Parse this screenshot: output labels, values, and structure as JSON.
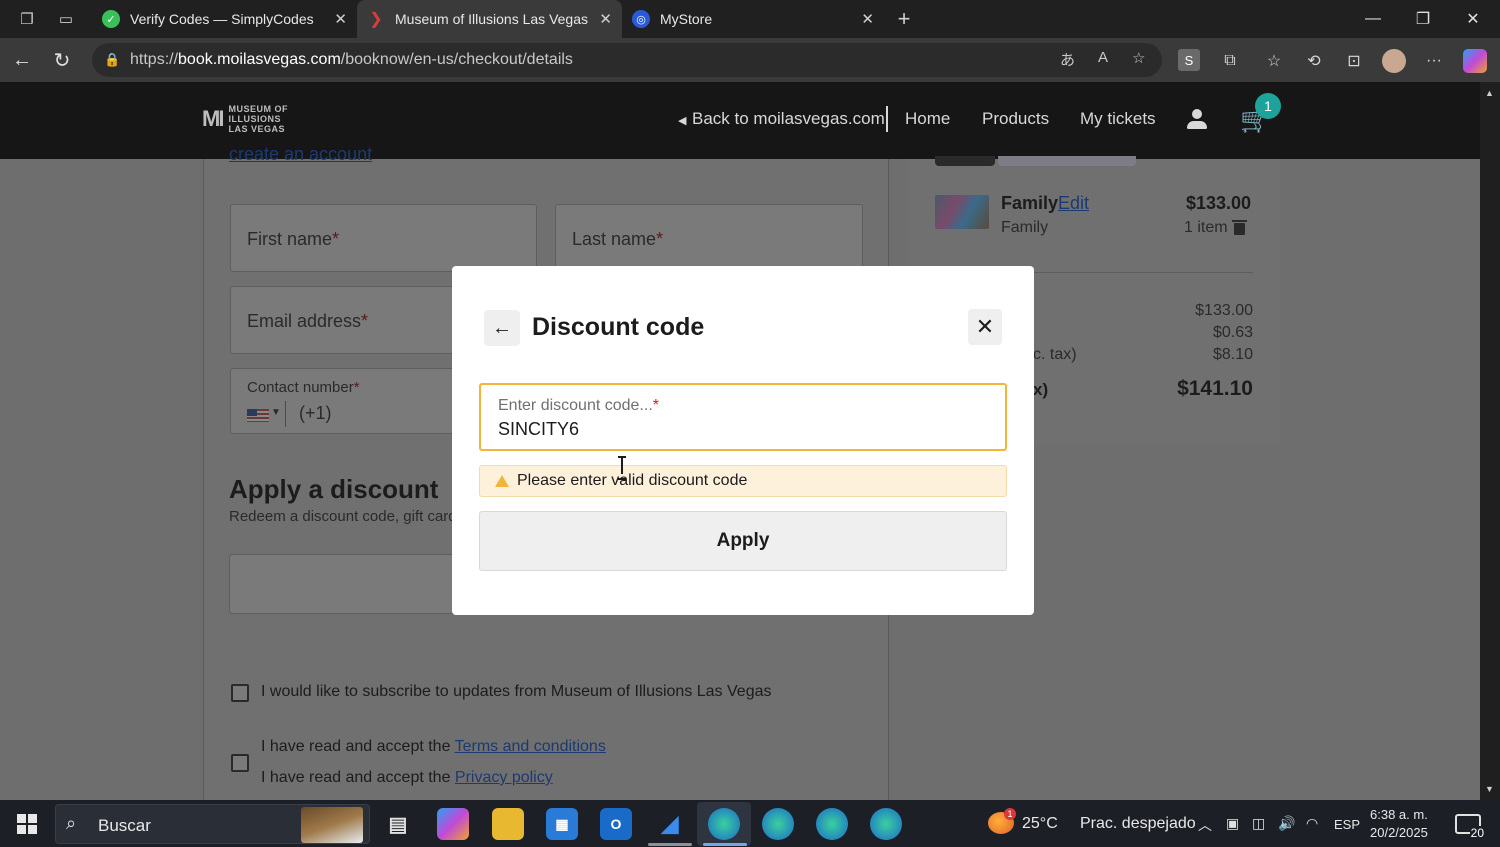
{
  "browser": {
    "tabs": [
      {
        "title": "Verify Codes — SimplyCodes",
        "favicon": "simplycodes-icon",
        "active": false
      },
      {
        "title": "Museum of Illusions Las Vegas onl",
        "favicon": "moi-icon",
        "active": true
      },
      {
        "title": "MyStore",
        "favicon": "mystore-icon",
        "active": false
      }
    ],
    "url_prefix": "https://",
    "url_domain": "book.moilasvegas.com",
    "url_path": "/booknow/en-us/checkout/details"
  },
  "site": {
    "logo": {
      "line1": "MUSEUM OF",
      "line2": "ILLUSIONS",
      "line3": "LAS VEGAS"
    },
    "nav": {
      "back_link": "Back to moilasvegas.com",
      "home": "Home",
      "products": "Products",
      "my_tickets": "My tickets"
    },
    "cart_count": "1"
  },
  "form": {
    "create_account": "create an account",
    "first_name": "First name",
    "last_name": "Last name",
    "email": "Email address",
    "contact_number": "Contact number",
    "dial_code": "(+1)",
    "required_mark": "*"
  },
  "discount_section": {
    "heading": "Apply a discount",
    "subtext": "Redeem a discount code, gift card"
  },
  "checkboxes": {
    "subscribe": "I would like to subscribe to updates from Museum of Illusions Las Vegas",
    "terms_prefix": "I have read and accept the ",
    "terms_link": "Terms and conditions",
    "privacy_prefix": "I have read and accept the ",
    "privacy_link": "Privacy policy"
  },
  "cart": {
    "item_name": "Family",
    "edit": "Edit",
    "item_sub": "Family",
    "item_price": "$133.00",
    "item_qty": "1 item",
    "summary": {
      "subtotal": "$133.00",
      "fee": "$0.63",
      "tax_label": "c. tax)",
      "tax": "$8.10",
      "total_label": "x)",
      "total": "$141.10"
    }
  },
  "modal": {
    "title": "Discount code",
    "input_placeholder": "Enter discount code...",
    "required_mark": "*",
    "input_value": "SINCITY6",
    "warning": "Please enter valid discount code",
    "apply": "Apply"
  },
  "taskbar": {
    "search": "Buscar",
    "weather_badge": "1",
    "temperature": "25°C",
    "weather": "Prac. despejado",
    "language": "ESP",
    "time": "6:38 a. m.",
    "date": "20/2/2025",
    "notifications": "20"
  },
  "colors": {
    "accent_teal": "#1ea39a",
    "warning": "#f2b53a",
    "link": "#1d3a70"
  }
}
